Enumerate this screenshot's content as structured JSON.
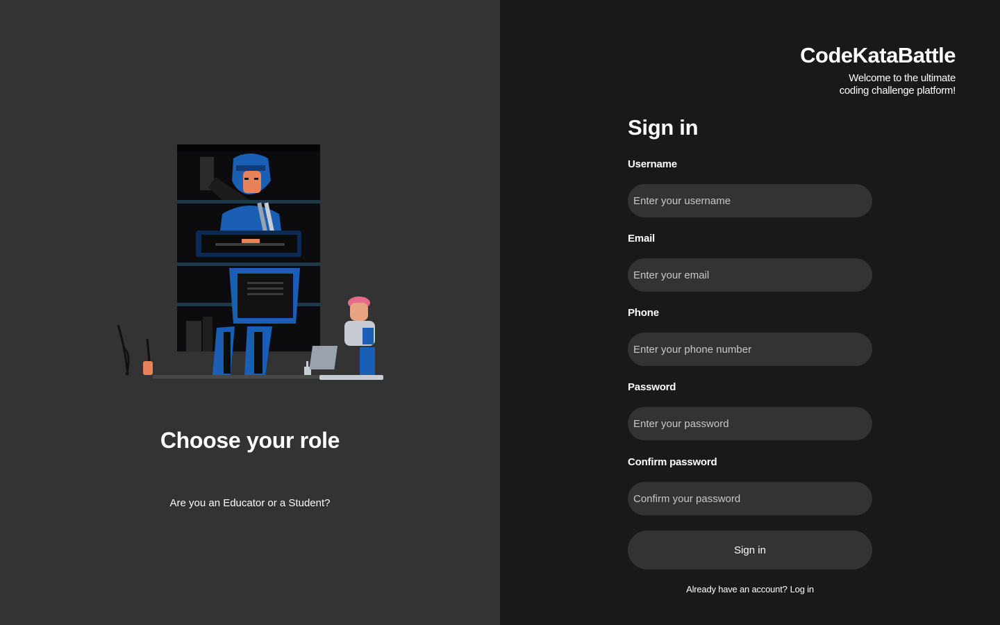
{
  "left_panel": {
    "title": "Choose your role",
    "subtitle": "Are you an Educator or a Student?"
  },
  "brand": {
    "name": "CodeKataBattle",
    "tagline": "Welcome to the ultimate coding challenge platform!"
  },
  "form": {
    "title": "Sign in",
    "fields": [
      {
        "label": "Username",
        "placeholder": "Enter your username",
        "value": ""
      },
      {
        "label": "Email",
        "placeholder": "Enter your email",
        "value": ""
      },
      {
        "label": "Phone",
        "placeholder": "Enter your phone number",
        "value": ""
      },
      {
        "label": "Password",
        "placeholder": "Enter your password",
        "value": ""
      },
      {
        "label": "Confirm password",
        "placeholder": "Confirm your password",
        "value": ""
      }
    ],
    "submit_label": "Sign in",
    "login_prompt": "Already have an account?",
    "login_link": "Log in"
  },
  "colors": {
    "left_bg": "#333333",
    "right_bg": "#191919",
    "input_bg": "#333333",
    "illustration_accent": "#1a5fb4",
    "illustration_skin": "#e8825a",
    "illustration_helmet_pink": "#e86a8a"
  }
}
